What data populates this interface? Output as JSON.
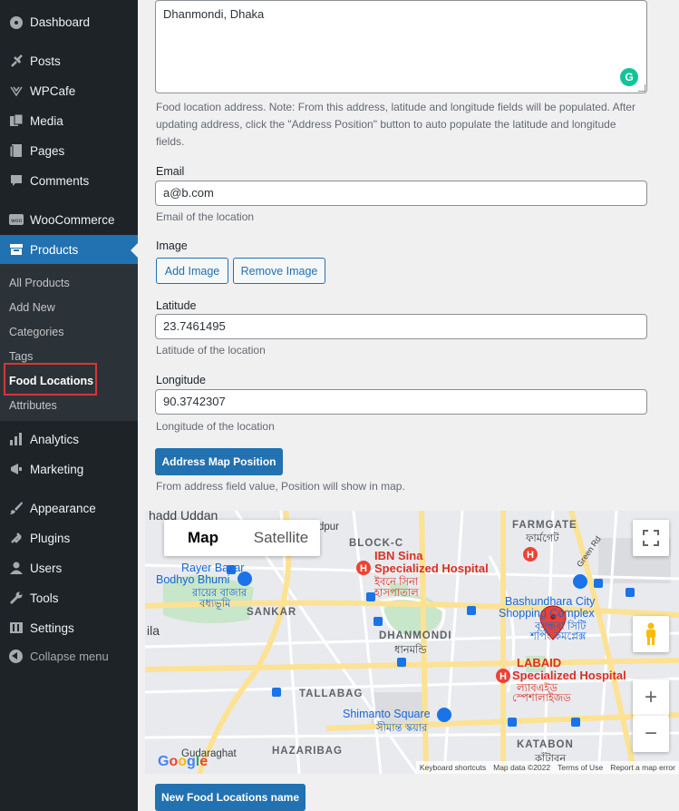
{
  "sidebar": {
    "menu": [
      {
        "label": "Dashboard",
        "icon": "dashboard-icon"
      },
      {
        "label": "Posts",
        "icon": "pin-icon"
      },
      {
        "label": "WPCafe",
        "icon": "cafe-icon"
      },
      {
        "label": "Media",
        "icon": "media-icon"
      },
      {
        "label": "Pages",
        "icon": "pages-icon"
      },
      {
        "label": "Comments",
        "icon": "comments-icon"
      },
      {
        "label": "WooCommerce",
        "icon": "woocommerce-icon"
      },
      {
        "label": "Products",
        "icon": "products-icon"
      },
      {
        "label": "Analytics",
        "icon": "analytics-icon"
      },
      {
        "label": "Marketing",
        "icon": "marketing-icon"
      },
      {
        "label": "Appearance",
        "icon": "appearance-icon"
      },
      {
        "label": "Plugins",
        "icon": "plugins-icon"
      },
      {
        "label": "Users",
        "icon": "users-icon"
      },
      {
        "label": "Tools",
        "icon": "tools-icon"
      },
      {
        "label": "Settings",
        "icon": "settings-icon"
      }
    ],
    "submenu": [
      "All Products",
      "Add New",
      "Categories",
      "Tags",
      "Food Locations",
      "Attributes"
    ],
    "collapse_label": "Collapse menu"
  },
  "form": {
    "address_value": "Dhanmondi, Dhaka",
    "address_desc": "Food location address. Note: From this address, latitude and longitude fields will be populated. After updating address, click the \"Address Position\" button to auto populate the latitude and longitude fields.",
    "email_label": "Email",
    "email_value": "a@b.com",
    "email_desc": "Email of the location",
    "image_label": "Image",
    "add_image": "Add Image",
    "remove_image": "Remove Image",
    "latitude_label": "Latitude",
    "latitude_value": "23.7461495",
    "latitude_desc": "Latitude of the location",
    "longitude_label": "Longitude",
    "longitude_value": "90.3742307",
    "longitude_desc": "Longitude of the location",
    "map_button": "Address Map Position",
    "map_desc": "From address field value, Position will show in map.",
    "new_button": "New Food Locations name"
  },
  "map": {
    "tab_map": "Map",
    "tab_satellite": "Satellite",
    "footer": {
      "shortcuts": "Keyboard shortcuts",
      "data": "Map data ©2022",
      "terms": "Terms of Use",
      "report": "Report a map error"
    },
    "labels": [
      {
        "text": "hadd Uddan",
        "cls": ""
      },
      {
        "text": "madpur",
        "cls": ""
      },
      {
        "text": "BLOCK-C",
        "cls": "bold"
      },
      {
        "text": "FARMGATE",
        "cls": "bold"
      },
      {
        "text": "ফার্মগেট",
        "cls": ""
      },
      {
        "text": "IBN Sina",
        "cls": "red"
      },
      {
        "text": "Specialized Hospital",
        "cls": "red"
      },
      {
        "text": "ইবনে সিনা",
        "cls": ""
      },
      {
        "text": "হাসপাতাল",
        "cls": ""
      },
      {
        "text": "Rayer Bazar",
        "cls": "blue"
      },
      {
        "text": "Bodhyo Bhumi",
        "cls": "blue"
      },
      {
        "text": "রায়ের বাজার",
        "cls": ""
      },
      {
        "text": "বধ্যভূমি",
        "cls": ""
      },
      {
        "text": "Bashundhara City",
        "cls": "blue"
      },
      {
        "text": "Shopping Complex",
        "cls": "blue"
      },
      {
        "text": "বসুন্ধরা সিটি",
        "cls": ""
      },
      {
        "text": "শপিং কমপ্লেক্স",
        "cls": ""
      },
      {
        "text": "SANKAR",
        "cls": "bold"
      },
      {
        "text": "DHANMONDI",
        "cls": "bold"
      },
      {
        "text": "ধানমন্ডি",
        "cls": ""
      },
      {
        "text": "ila",
        "cls": ""
      },
      {
        "text": "LABAID",
        "cls": "red"
      },
      {
        "text": "Specialized Hospital",
        "cls": "red"
      },
      {
        "text": "ল্যাবএইড",
        "cls": ""
      },
      {
        "text": "স্পেশালাইজড",
        "cls": ""
      },
      {
        "text": "TALLABAG",
        "cls": "bold"
      },
      {
        "text": "Shimanto Square",
        "cls": "blue"
      },
      {
        "text": "সীমান্ত স্কয়ার",
        "cls": ""
      },
      {
        "text": "HAZARIBAG",
        "cls": "bold"
      },
      {
        "text": "KATABON",
        "cls": "bold"
      },
      {
        "text": "কাঁটাবন",
        "cls": ""
      },
      {
        "text": "Gudaraghat",
        "cls": ""
      },
      {
        "text": "Green Rd",
        "cls": ""
      }
    ]
  }
}
